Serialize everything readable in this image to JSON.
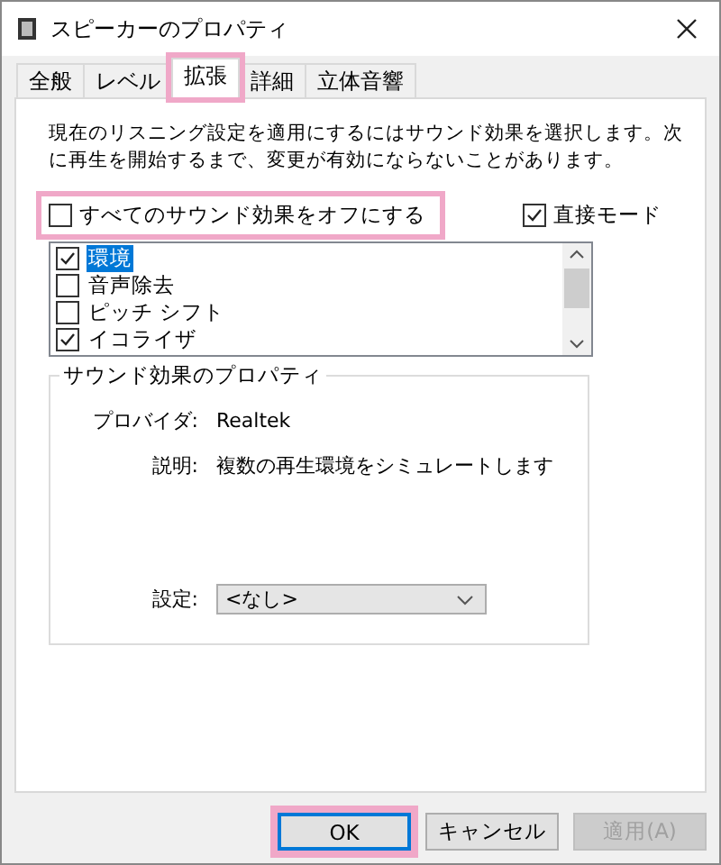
{
  "window": {
    "title": "スピーカーのプロパティ"
  },
  "tabs": [
    {
      "label": "全般",
      "selected": false,
      "highlighted": false
    },
    {
      "label": "レベル",
      "selected": false,
      "highlighted": false
    },
    {
      "label": "拡張",
      "selected": true,
      "highlighted": true
    },
    {
      "label": "詳細",
      "selected": false,
      "highlighted": false
    },
    {
      "label": "立体音響",
      "selected": false,
      "highlighted": false
    }
  ],
  "description": "現在のリスニング設定を適用にするにはサウンド効果を選択します。次に再生を開始するまで、変更が有効にならないことがあります。",
  "options": [
    {
      "label": "すべてのサウンド効果をオフにする",
      "checked": false,
      "highlighted": true
    },
    {
      "label": "直接モード",
      "checked": true,
      "highlighted": false
    }
  ],
  "effects": [
    {
      "label": "環境",
      "checked": true,
      "selected": true
    },
    {
      "label": "音声除去",
      "checked": false,
      "selected": false
    },
    {
      "label": "ピッチ シフト",
      "checked": false,
      "selected": false
    },
    {
      "label": "イコライザ",
      "checked": true,
      "selected": false
    }
  ],
  "properties": {
    "title": "サウンド効果のプロパティ",
    "fields": [
      {
        "label": "プロバイダ:",
        "value": "Realtek"
      },
      {
        "label": "説明:",
        "value": "複数の再生環境をシミュレートします"
      }
    ],
    "setting": {
      "label": "設定:",
      "value": "<なし>"
    }
  },
  "buttons": [
    {
      "label": "OK",
      "default": true,
      "disabled": false,
      "highlighted": true
    },
    {
      "label": "キャンセル",
      "default": false,
      "disabled": false,
      "highlighted": false
    },
    {
      "label": "適用(A)",
      "default": false,
      "disabled": true,
      "highlighted": false
    }
  ]
}
